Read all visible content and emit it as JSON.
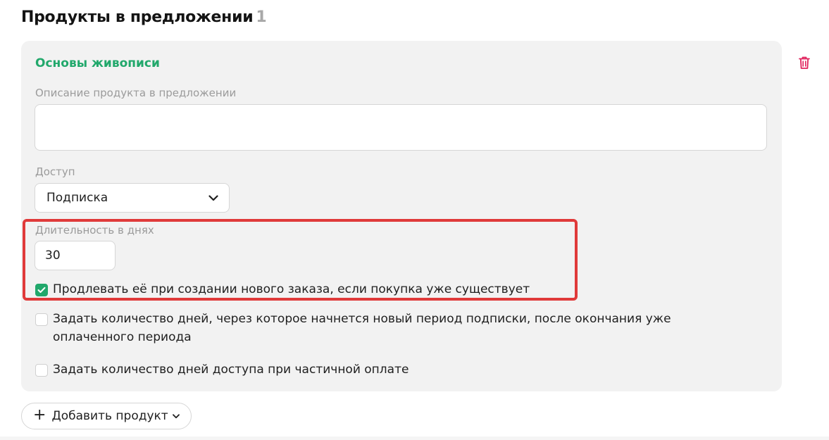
{
  "header": {
    "title": "Продукты в предложении",
    "count": "1"
  },
  "product": {
    "name": "Основы живописи",
    "description_label": "Описание продукта в предложении",
    "description_value": "",
    "access_label": "Доступ",
    "access_value": "Подписка",
    "duration_label": "Длительность в днях",
    "duration_value": "30",
    "options": [
      {
        "label": "Продлевать её при создании нового заказа, если покупка уже существует",
        "checked": true
      },
      {
        "label": "Задать количество дней, через которое начнется новый период подписки, после окончания уже оплаченного периода",
        "checked": false
      },
      {
        "label": "Задать количество дней доступа при частичной оплате",
        "checked": false
      }
    ]
  },
  "actions": {
    "add_product_label": "Добавить продукт",
    "add_icon": "plus-icon",
    "delete_icon": "trash-icon"
  },
  "colors": {
    "accent_green": "#21a86b",
    "highlight_red": "#e03a3a",
    "delete_red": "#e0245e",
    "card_bg": "#f2f2f2"
  }
}
